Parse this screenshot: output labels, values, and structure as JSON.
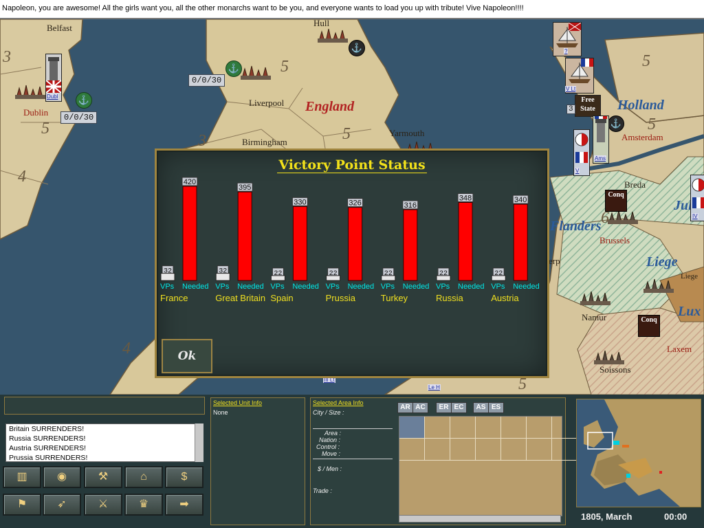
{
  "message": "Napoleon, you are awesome! All the girls want you, all the other monarchs want to be you, and everyone wants to load you up with tribute!   Vive Napoleon!!!!",
  "map": {
    "regions": [
      "England",
      "Holland",
      "Flanders",
      "Liege",
      "Jul",
      "Lux"
    ],
    "towns": [
      "Belfast",
      "Hull",
      "Dublin",
      "Liverpool",
      "Yarmouth",
      "Birmingham",
      "Amsterdam",
      "Breda",
      "Brussels",
      "Namur",
      "Soissons",
      "Liege",
      "Laxem",
      "erp"
    ],
    "area_numbers": [
      "3",
      "5",
      "5",
      "5",
      "3",
      "4",
      "4",
      "5",
      "5",
      "5",
      "6",
      "5"
    ],
    "counters": [
      "0/0/30",
      "0/0/30"
    ],
    "unit_tags": [
      "Dubl",
      "V Lt",
      "Ams",
      "V",
      "IV",
      "Le H",
      "III Lt"
    ],
    "free_state_label": "Free State",
    "free_state_number": "3",
    "conq_label": "Conq",
    "unit_question": "?"
  },
  "dialog": {
    "title": "Victory Point Status",
    "ok_label": "Ok"
  },
  "chart_data": {
    "type": "bar",
    "title": "Victory Point Status",
    "categories": [
      "France",
      "Great Britain",
      "Spain",
      "Prussia",
      "Turkey",
      "Russia",
      "Austria"
    ],
    "series": [
      {
        "name": "VPs",
        "values": [
          32,
          32,
          22,
          22,
          22,
          22,
          22
        ]
      },
      {
        "name": "Needed",
        "values": [
          420,
          395,
          330,
          326,
          316,
          348,
          340
        ]
      }
    ],
    "vps_value_labels": [
      "32",
      "32",
      "22",
      "22",
      "22",
      "22",
      "22"
    ],
    "ylim": [
      0,
      420
    ],
    "colors": {
      "vps": "#e8e8e8",
      "needed": "#ff0000",
      "label": "#00e8e8",
      "category": "#f0e020"
    }
  },
  "bottom": {
    "log": [
      "Britain SURRENDERS!",
      "Russia SURRENDERS!",
      "Austria SURRENDERS!",
      "Prussia SURRENDERS!"
    ],
    "unit_info_title": "Selected Unit Info",
    "unit_info_value": "None",
    "area_info_title": "Selected Area Info",
    "area_fields": [
      "City / Size :",
      "Area :",
      "Nation :",
      "Control :",
      "Move :",
      "$ / Men :",
      "Trade :"
    ],
    "tabs": [
      "AR",
      "AC",
      "ER",
      "EC",
      "AS",
      "ES"
    ],
    "date": "1805, March",
    "time": "00:00",
    "buttons": [
      "chart-icon",
      "coins-icon",
      "trade-icon",
      "ship-build-icon",
      "factory-icon",
      "money-icon",
      "map-flag-icon",
      "dispatch-icon",
      "armies-icon",
      "crown-icon",
      "next-arrow-icon"
    ]
  }
}
